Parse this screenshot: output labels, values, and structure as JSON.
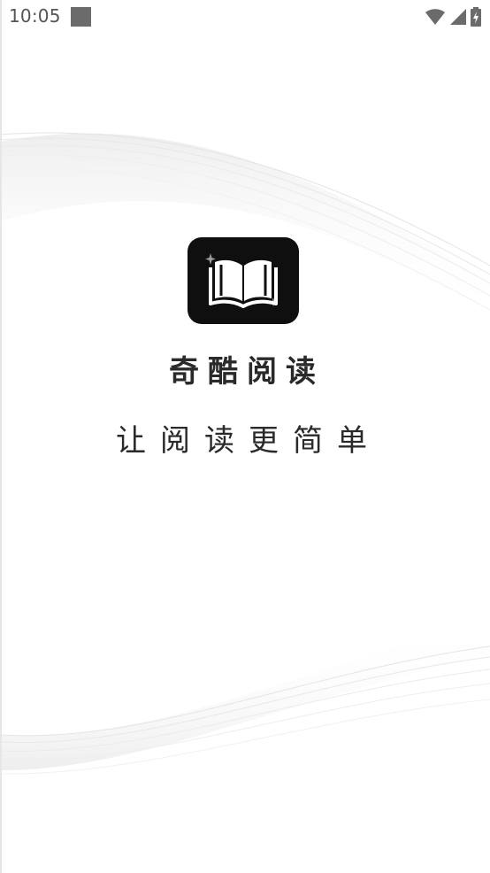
{
  "status_bar": {
    "time": "10:05",
    "notification_icon": "square-notification-icon",
    "wifi_icon": "wifi-icon",
    "signal_icon": "signal-icon",
    "battery_icon": "battery-charging-icon"
  },
  "splash": {
    "logo_icon": "open-book-icon",
    "app_name": "奇酷阅读",
    "tagline": "让阅读更简单"
  },
  "colors": {
    "background": "#ffffff",
    "logo_background": "#0f0f0f",
    "text": "#2a2a2a",
    "wave": "#e2e2e2"
  }
}
